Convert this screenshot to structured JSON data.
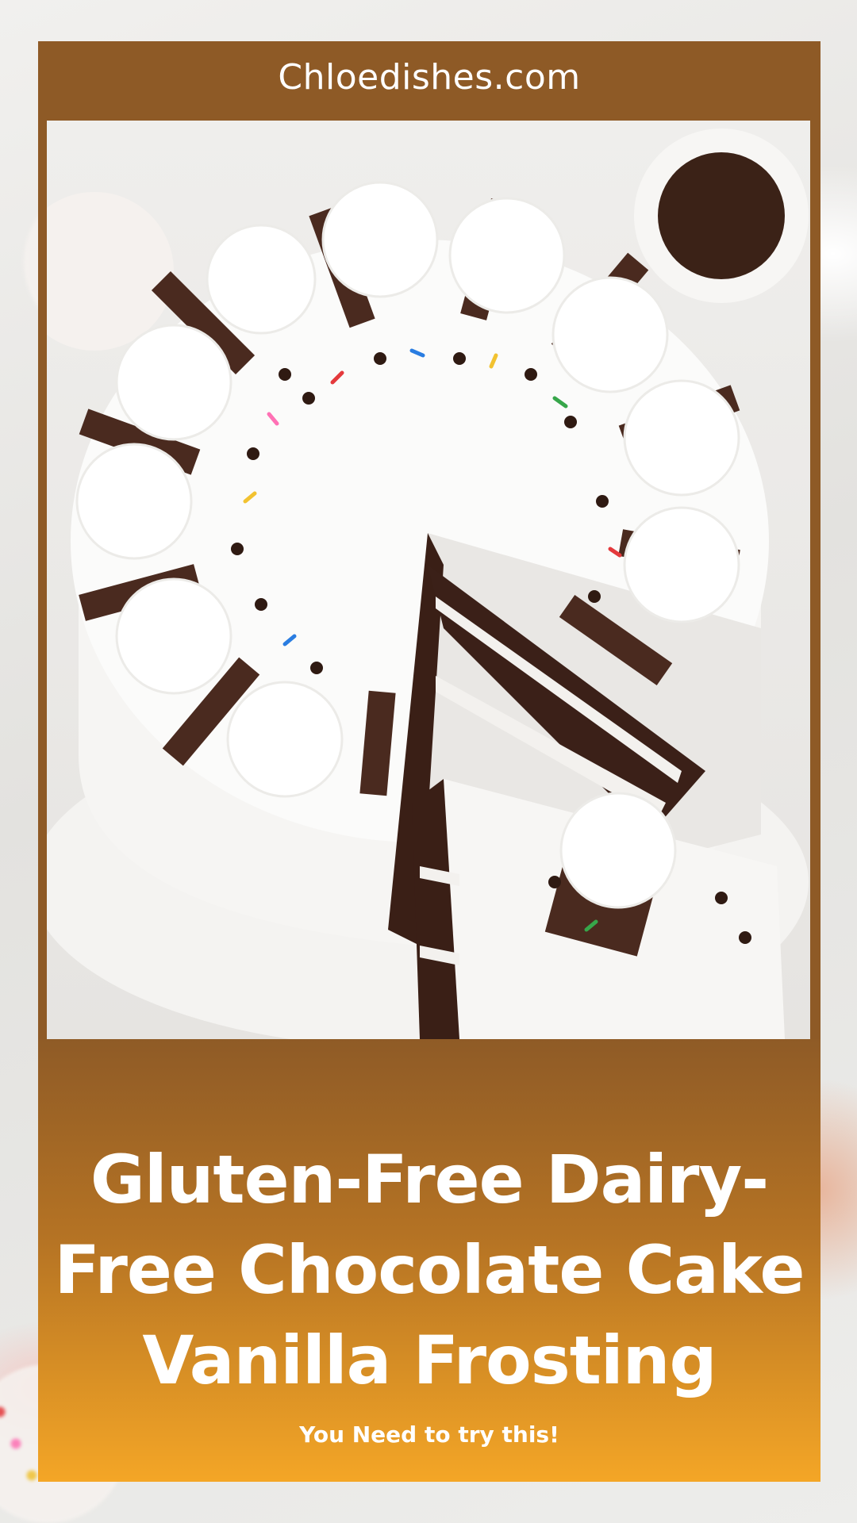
{
  "header": {
    "site_name": "Chloedishes.com"
  },
  "photo": {
    "subject": "cake-image"
  },
  "footer": {
    "title": "Gluten-Free Dairy-Free Chocolate Cake Vanilla Frosting",
    "tagline": "You Need to try this!"
  },
  "colors": {
    "brand_brown": "#8e5a26",
    "gradient_end": "#f4a626",
    "text": "#ffffff"
  }
}
